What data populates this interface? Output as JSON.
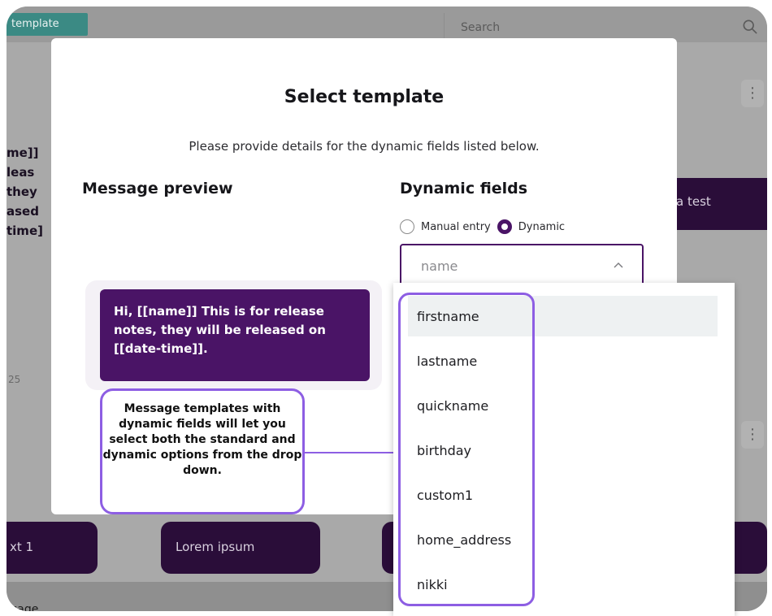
{
  "background": {
    "tab_label": "template",
    "search_placeholder": "Search",
    "left_bubble_text": "me]]\nleas\nthey\nased\ntime]",
    "right_bubble_text": "a test",
    "bottom_bubbles": [
      "xt 1",
      "Lorem ipsum"
    ],
    "row_number": "25",
    "bottom_text": "sage"
  },
  "modal": {
    "title": "Select template",
    "subtitle": "Please provide details for the dynamic fields listed below.",
    "preview_heading": "Message preview",
    "fields_heading": "Dynamic fields",
    "radio_manual": "Manual entry",
    "radio_dynamic": "Dynamic",
    "selected_mode": "Dynamic",
    "select_value": "name",
    "preview_message": "Hi, [[name]] This is for release notes, they will be released on [[date-time]]."
  },
  "callout": {
    "text": "Message templates with dynamic fields will let you select both the standard and dynamic options from the drop down."
  },
  "dropdown": {
    "options": [
      "firstname",
      "lastname",
      "quickname",
      "birthday",
      "custom1",
      "home_address",
      "nikki"
    ],
    "highlighted": "firstname"
  },
  "colors": {
    "brand_purple": "#4a1466",
    "callout_outline": "#8d5ee3",
    "tab_teal": "#3b8a84"
  }
}
